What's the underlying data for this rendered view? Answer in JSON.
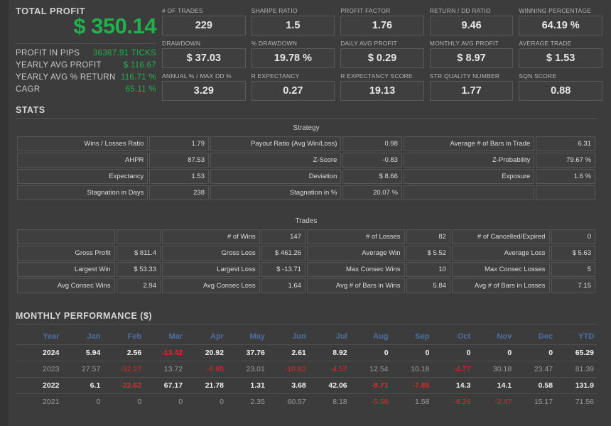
{
  "summary": {
    "title": "TOTAL PROFIT",
    "value": "$ 350.14",
    "rows": [
      {
        "label": "PROFIT IN PIPS",
        "value": "36387.91 TICKS"
      },
      {
        "label": "YEARLY AVG PROFIT",
        "value": "$ 116.67"
      },
      {
        "label": "YEARLY AVG % RETURN",
        "value": "116.71 %"
      },
      {
        "label": "CAGR",
        "value": "65.11 %"
      }
    ],
    "accent_color": "#21b14b"
  },
  "metrics": [
    {
      "label": "# OF TRADES",
      "value": "229"
    },
    {
      "label": "SHARPE RATIO",
      "value": "1.5"
    },
    {
      "label": "PROFIT FACTOR",
      "value": "1.76"
    },
    {
      "label": "RETURN / DD RATIO",
      "value": "9.46"
    },
    {
      "label": "WINNING PERCENTAGE",
      "value": "64.19 %"
    },
    {
      "label": "DRAWDOWN",
      "value": "$ 37.03"
    },
    {
      "label": "% DRAWDOWN",
      "value": "19.78 %"
    },
    {
      "label": "DAILY AVG PROFIT",
      "value": "$ 0.29"
    },
    {
      "label": "MONTHLY AVG PROFIT",
      "value": "$ 8.97"
    },
    {
      "label": "AVERAGE TRADE",
      "value": "$ 1.53"
    },
    {
      "label": "ANNUAL % / MAX DD %",
      "value": "3.29"
    },
    {
      "label": "R EXPECTANCY",
      "value": "0.27"
    },
    {
      "label": "R EXPECTANCY SCORE",
      "value": "19.13"
    },
    {
      "label": "STR QUALITY NUMBER",
      "value": "1.77"
    },
    {
      "label": "SQN SCORE",
      "value": "0.88"
    }
  ],
  "stats": {
    "section_title": "STATS",
    "strategy": {
      "caption": "Strategy",
      "rows": [
        [
          "Wins / Losses Ratio",
          "1.79",
          "Payout Ratio (Avg Win/Loss)",
          "0.98",
          "Average # of Bars in Trade",
          "6.31"
        ],
        [
          "AHPR",
          "87.53",
          "Z-Score",
          "-0.83",
          "Z-Probability",
          "79.67 %"
        ],
        [
          "Expectancy",
          "1.53",
          "Deviation",
          "$ 8.66",
          "Exposure",
          "1.6 %"
        ],
        [
          "Stagnation in Days",
          "238",
          "Stagnation in %",
          "20.07 %",
          "",
          ""
        ]
      ]
    },
    "trades": {
      "caption": "Trades",
      "rows": [
        [
          "",
          "",
          "# of Wins",
          "147",
          "# of Losses",
          "82",
          "# of Cancelled/Expired",
          "0"
        ],
        [
          "Gross Profit",
          "$ 811.4",
          "Gross Loss",
          "$ 461.26",
          "Average Win",
          "$ 5.52",
          "Average Loss",
          "$ 5.63"
        ],
        [
          "Largest Win",
          "$ 53.33",
          "Largest Loss",
          "$ -13.71",
          "Max Consec Wins",
          "10",
          "Max Consec Losses",
          "5"
        ],
        [
          "Avg Consec Wins",
          "2.94",
          "Avg Consec Loss",
          "1.64",
          "Avg # of Bars in Wins",
          "5.84",
          "Avg # of Bars in Losses",
          "7.15"
        ]
      ]
    }
  },
  "monthly": {
    "section_title": "MONTHLY PERFORMANCE ($)",
    "header_color": "#4c6fa3",
    "negative_color": "#e02a2a",
    "columns": [
      "Year",
      "Jan",
      "Feb",
      "Mar",
      "Apr",
      "May",
      "Jun",
      "Jul",
      "Aug",
      "Sep",
      "Oct",
      "Nov",
      "Dec",
      "YTD"
    ],
    "rows": [
      {
        "year": "2024",
        "values": [
          "5.94",
          "2.56",
          "-13.42",
          "20.92",
          "37.76",
          "2.61",
          "8.92",
          "0",
          "0",
          "0",
          "0",
          "0",
          "65.29"
        ]
      },
      {
        "year": "2023",
        "values": [
          "27.57",
          "-32.27",
          "13.72",
          "-6.85",
          "23.01",
          "-10.82",
          "-4.57",
          "12.54",
          "10.18",
          "-4.77",
          "30.18",
          "23.47",
          "81.39"
        ]
      },
      {
        "year": "2022",
        "values": [
          "6.1",
          "-22.62",
          "67.17",
          "21.78",
          "1.31",
          "3.68",
          "42.06",
          "-8.71",
          "-7.85",
          "14.3",
          "14.1",
          "0.58",
          "131.9"
        ]
      },
      {
        "year": "2021",
        "values": [
          "0",
          "0",
          "0",
          "0",
          "2.35",
          "60.57",
          "8.18",
          "-5.56",
          "1.58",
          "-8.26",
          "-2.47",
          "15.17",
          "71.56"
        ]
      }
    ]
  }
}
